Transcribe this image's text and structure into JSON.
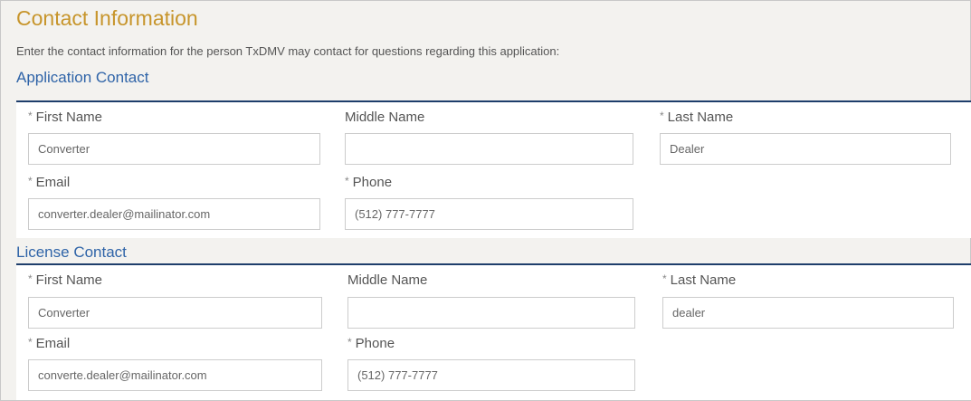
{
  "title": "Contact Information",
  "description": "Enter the contact information for the person TxDMV may contact for questions regarding this application:",
  "required_marker": "*",
  "application_contact": {
    "heading": "Application Contact",
    "labels": {
      "first_name": "First Name",
      "middle_name": "Middle Name",
      "last_name": "Last Name",
      "email": "Email",
      "phone": "Phone"
    },
    "values": {
      "first_name": "Converter",
      "middle_name": "",
      "last_name": "Dealer",
      "email": "converter.dealer@mailinator.com",
      "phone": "(512) 777-7777"
    }
  },
  "license_contact": {
    "heading": "License Contact",
    "labels": {
      "first_name": "First Name",
      "middle_name": "Middle Name",
      "last_name": "Last Name",
      "email": "Email",
      "phone": "Phone"
    },
    "values": {
      "first_name": "Converter",
      "middle_name": "",
      "last_name": "dealer",
      "email": "converte.dealer@mailinator.com",
      "phone": "(512) 777-7777"
    }
  }
}
